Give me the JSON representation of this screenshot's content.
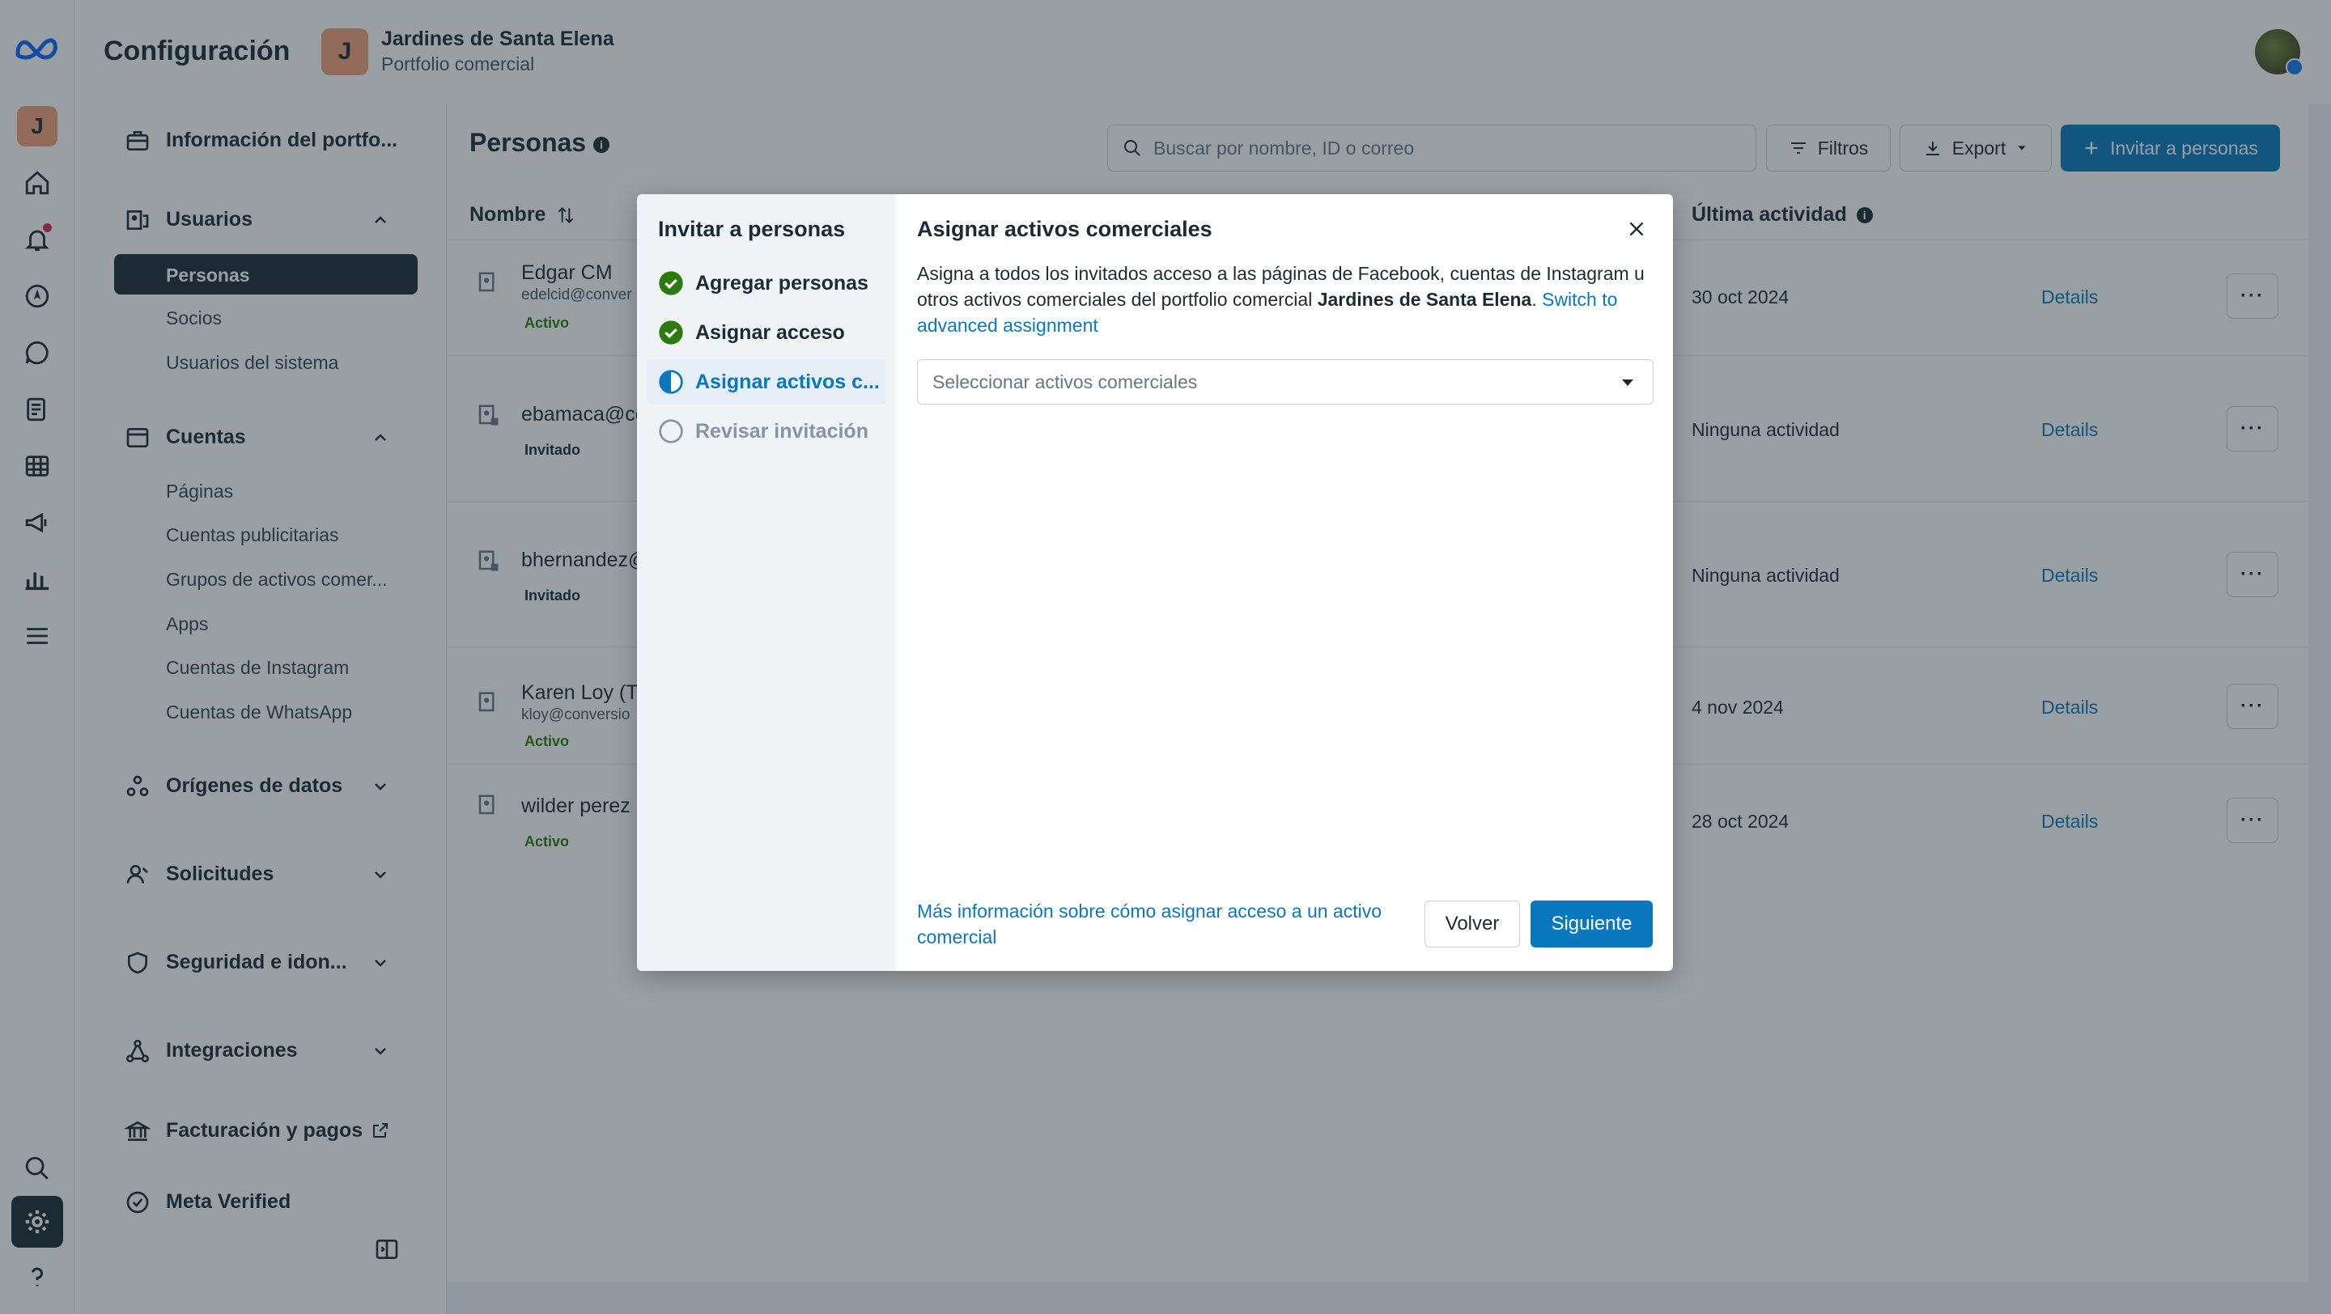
{
  "header": {
    "app_title": "Configuración",
    "org_initial": "J",
    "org_name": "Jardines de Santa Elena",
    "org_subtitle": "Portfolio comercial"
  },
  "rail": {
    "org_initial": "J",
    "icons": [
      "meta-logo-icon",
      "home-icon",
      "notifications-icon",
      "compass-icon",
      "chat-icon",
      "pages-icon",
      "table-icon",
      "megaphone-icon",
      "chart-icon",
      "menu-icon",
      "search-icon",
      "settings-icon",
      "help-icon"
    ]
  },
  "sidebar": {
    "portfolio_info": "Información del portfo...",
    "users": {
      "label": "Usuarios",
      "items": [
        "Personas",
        "Socios",
        "Usuarios del sistema"
      ]
    },
    "accounts": {
      "label": "Cuentas",
      "items": [
        "Páginas",
        "Cuentas publicitarias",
        "Grupos de activos comer...",
        "Apps",
        "Cuentas de Instagram",
        "Cuentas de WhatsApp"
      ]
    },
    "data_sources": "Orígenes de datos",
    "requests": "Solicitudes",
    "security": "Seguridad e idon...",
    "integrations": "Integraciones",
    "billing": "Facturación y pagos",
    "verified": "Meta Verified"
  },
  "main": {
    "title": "Personas",
    "search_placeholder": "Buscar por nombre, ID o correo",
    "filters_label": "Filtros",
    "export_label": "Export",
    "invite_label": "Invitar a personas",
    "col_name": "Nombre",
    "col_activity": "Última actividad",
    "details_label": "Details",
    "rows": [
      {
        "name": "Edgar CM",
        "email": "edelcid@conver",
        "status": "Activo",
        "activity": "30 oct 2024"
      },
      {
        "name": "ebamaca@co",
        "email": "",
        "status": "Invitado",
        "activity": "Ninguna actividad"
      },
      {
        "name": "bhernandez@",
        "email": "",
        "status": "Invitado",
        "activity": "Ninguna actividad"
      },
      {
        "name": "Karen Loy (Tr",
        "email": "kloy@conversio",
        "status": "Activo",
        "activity": "4 nov 2024"
      },
      {
        "name": "wilder perez",
        "email": "",
        "status": "Activo",
        "activity": "28 oct 2024"
      }
    ]
  },
  "modal": {
    "steps_title": "Invitar a personas",
    "steps": [
      {
        "label": "Agregar personas",
        "state": "done"
      },
      {
        "label": "Asignar acceso",
        "state": "done"
      },
      {
        "label": "Asignar activos c...",
        "state": "current"
      },
      {
        "label": "Revisar invitación",
        "state": "pending"
      }
    ],
    "panel_title": "Asignar activos comerciales",
    "desc_prefix": "Asigna a todos los invitados acceso a las páginas de Facebook, cuentas de Instagram u otros activos comerciales del portfolio comercial ",
    "desc_org": "Jardines de Santa Elena",
    "desc_period": ". ",
    "desc_link": "Switch to advanced assignment",
    "select_placeholder": "Seleccionar activos comerciales",
    "help_link": "Más información sobre cómo asignar acceso a un activo comercial",
    "back_label": "Volver",
    "next_label": "Siguiente"
  },
  "colors": {
    "primary": "#0a78be",
    "dark": "#1c2b33",
    "success": "#2b7a0b",
    "org_avatar": "#f5a07a"
  }
}
